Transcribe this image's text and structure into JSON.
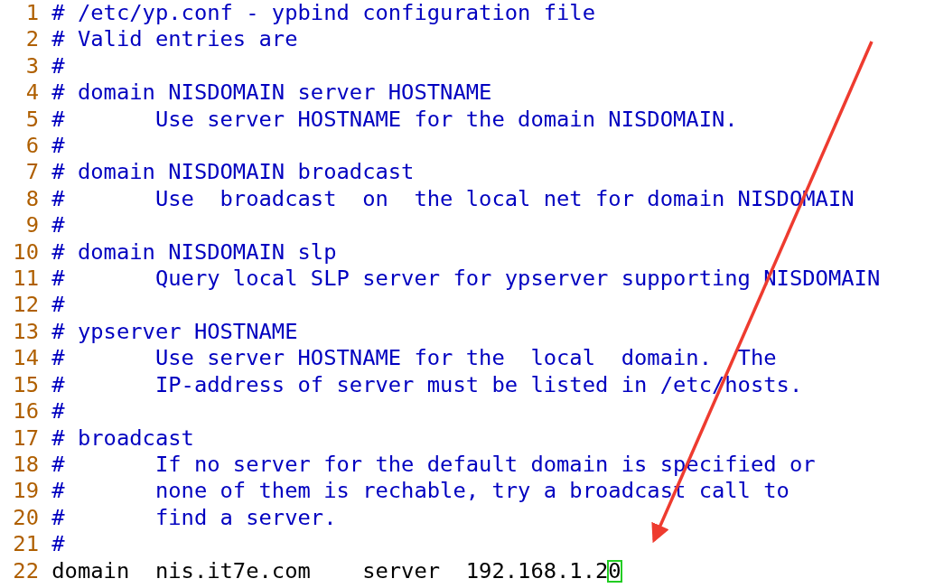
{
  "editor": {
    "lines": [
      {
        "number": "1",
        "kind": "comment",
        "text": "# /etc/yp.conf - ypbind configuration file"
      },
      {
        "number": "2",
        "kind": "comment",
        "text": "# Valid entries are"
      },
      {
        "number": "3",
        "kind": "comment",
        "text": "#"
      },
      {
        "number": "4",
        "kind": "comment",
        "text": "# domain NISDOMAIN server HOSTNAME"
      },
      {
        "number": "5",
        "kind": "comment",
        "text": "#       Use server HOSTNAME for the domain NISDOMAIN."
      },
      {
        "number": "6",
        "kind": "comment",
        "text": "#"
      },
      {
        "number": "7",
        "kind": "comment",
        "text": "# domain NISDOMAIN broadcast"
      },
      {
        "number": "8",
        "kind": "comment",
        "text": "#       Use  broadcast  on  the local net for domain NISDOMAIN"
      },
      {
        "number": "9",
        "kind": "comment",
        "text": "#"
      },
      {
        "number": "10",
        "kind": "comment",
        "text": "# domain NISDOMAIN slp"
      },
      {
        "number": "11",
        "kind": "comment",
        "text": "#       Query local SLP server for ypserver supporting NISDOMAIN"
      },
      {
        "number": "12",
        "kind": "comment",
        "text": "#"
      },
      {
        "number": "13",
        "kind": "comment",
        "text": "# ypserver HOSTNAME"
      },
      {
        "number": "14",
        "kind": "comment",
        "text": "#       Use server HOSTNAME for the  local  domain.  The"
      },
      {
        "number": "15",
        "kind": "comment",
        "text": "#       IP-address of server must be listed in /etc/hosts."
      },
      {
        "number": "16",
        "kind": "comment",
        "text": "#"
      },
      {
        "number": "17",
        "kind": "comment",
        "text": "# broadcast"
      },
      {
        "number": "18",
        "kind": "comment",
        "text": "#       If no server for the default domain is specified or"
      },
      {
        "number": "19",
        "kind": "comment",
        "text": "#       none of them is rechable, try a broadcast call to"
      },
      {
        "number": "20",
        "kind": "comment",
        "text": "#       find a server."
      },
      {
        "number": "21",
        "kind": "comment",
        "text": "#"
      },
      {
        "number": "22",
        "kind": "code",
        "text": "domain  nis.it7e.com    server  192.168.1.2",
        "cursor_text": "0"
      }
    ]
  }
}
